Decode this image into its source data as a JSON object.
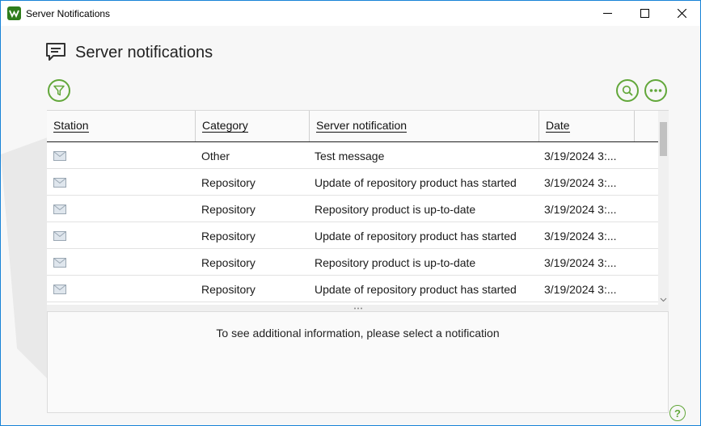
{
  "window": {
    "title": "Server Notifications"
  },
  "header": {
    "title": "Server notifications"
  },
  "toolbar": {
    "filter_icon": "filter-icon",
    "search_icon": "search-icon",
    "more_icon": "more-icon"
  },
  "table": {
    "columns": [
      "Station",
      "Category",
      "Server notification",
      "Date"
    ],
    "rows": [
      {
        "station_icon": "envelope-icon",
        "category": "Other",
        "notification": "Test message",
        "date": "3/19/2024 3:..."
      },
      {
        "station_icon": "envelope-icon",
        "category": "Repository",
        "notification": "Update of repository product has started",
        "date": "3/19/2024 3:..."
      },
      {
        "station_icon": "envelope-icon",
        "category": "Repository",
        "notification": "Repository product is up-to-date",
        "date": "3/19/2024 3:..."
      },
      {
        "station_icon": "envelope-icon",
        "category": "Repository",
        "notification": "Update of repository product has started",
        "date": "3/19/2024 3:..."
      },
      {
        "station_icon": "envelope-icon",
        "category": "Repository",
        "notification": "Repository product is up-to-date",
        "date": "3/19/2024 3:..."
      },
      {
        "station_icon": "envelope-icon",
        "category": "Repository",
        "notification": "Update of repository product has started",
        "date": "3/19/2024 3:..."
      }
    ]
  },
  "details": {
    "placeholder": "To see additional information, please select a notification"
  },
  "help": {
    "label": "?"
  },
  "colors": {
    "accent": "#62a73a",
    "window_border": "#1883d7"
  }
}
